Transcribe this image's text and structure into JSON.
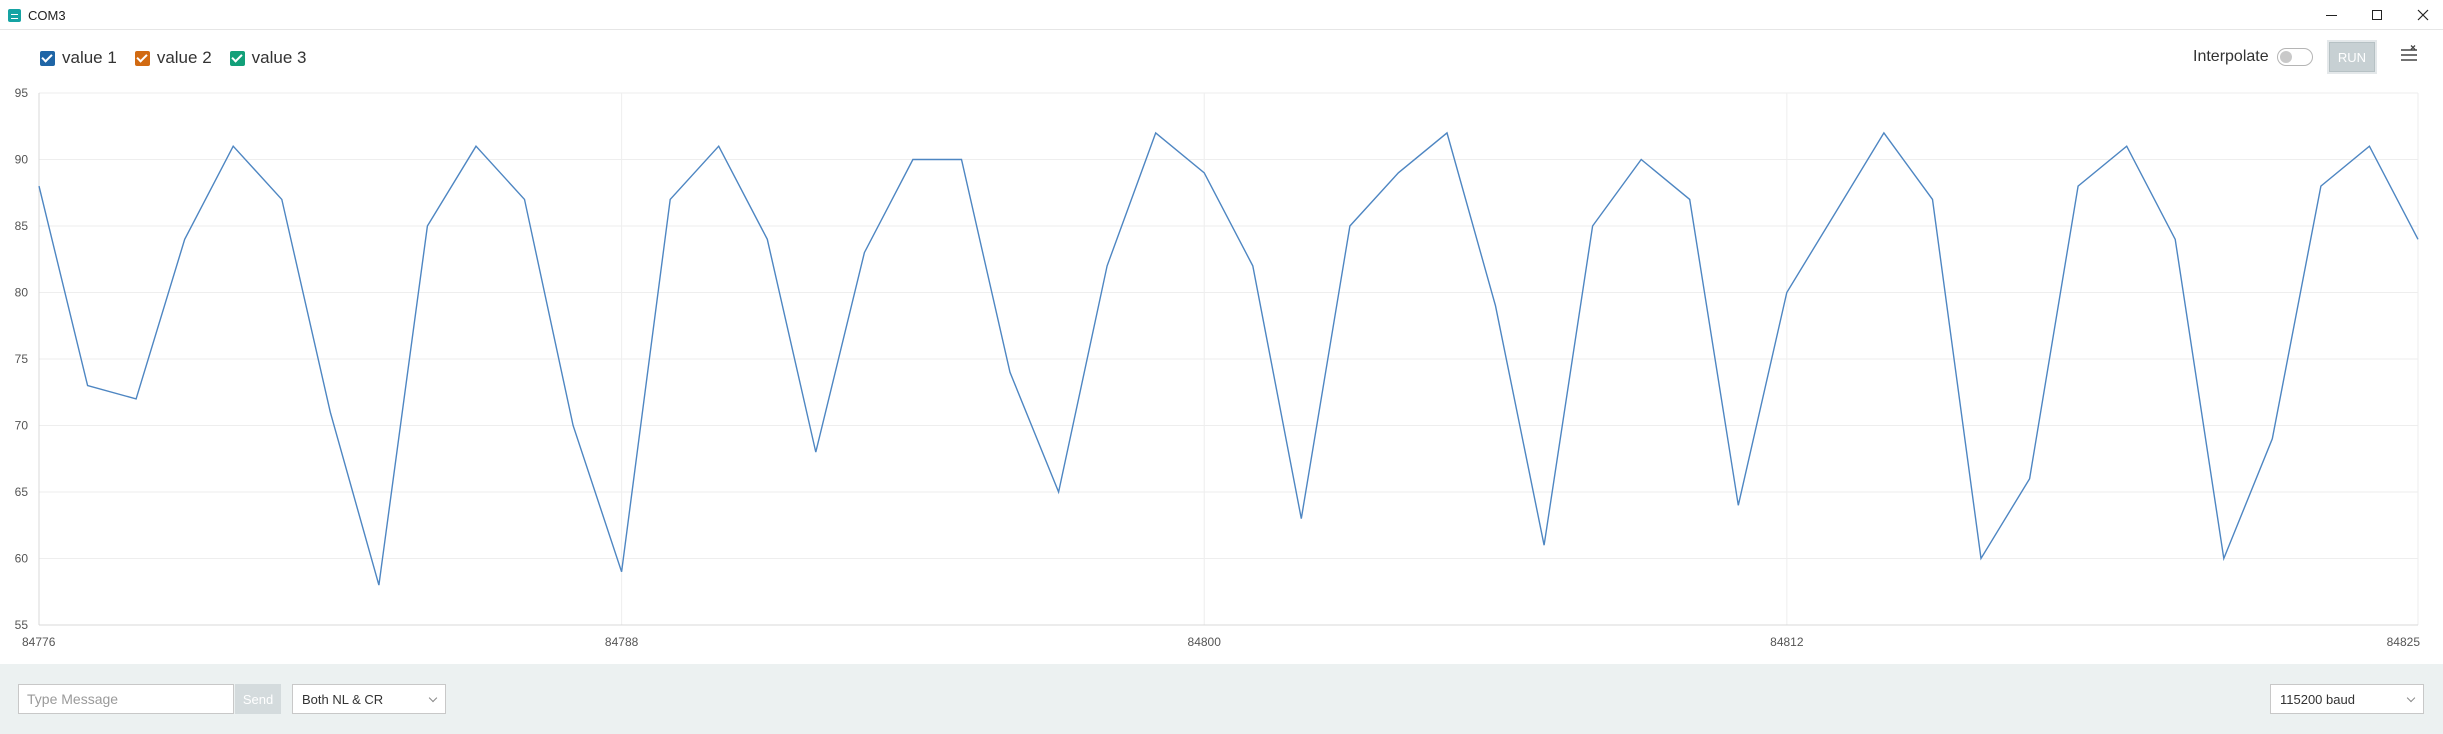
{
  "window": {
    "title": "COM3"
  },
  "legend": [
    {
      "label": "value 1",
      "color": "#1f65a6"
    },
    {
      "label": "value 2",
      "color": "#d16a12"
    },
    {
      "label": "value 3",
      "color": "#12a079"
    }
  ],
  "toolbar": {
    "interpolate_label": "Interpolate",
    "interpolate_on": false,
    "run_label": "RUN"
  },
  "chart_data": {
    "type": "line",
    "x": [
      84776,
      84777,
      84778,
      84779,
      84780,
      84781,
      84782,
      84783,
      84784,
      84785,
      84786,
      84787,
      84788,
      84789,
      84790,
      84791,
      84792,
      84793,
      84794,
      84795,
      84796,
      84797,
      84798,
      84799,
      84800,
      84801,
      84802,
      84803,
      84804,
      84805,
      84806,
      84807,
      84808,
      84809,
      84810,
      84811,
      84812,
      84813,
      84814,
      84815,
      84816,
      84817,
      84818,
      84819,
      84820,
      84821,
      84822,
      84823,
      84824,
      84825
    ],
    "series": [
      {
        "name": "value 1",
        "color": "#4e86c2",
        "values": [
          88,
          73,
          72,
          84,
          91,
          87,
          71,
          58,
          85,
          91,
          87,
          70,
          59,
          87,
          91,
          84,
          68,
          83,
          90,
          90,
          74,
          65,
          82,
          92,
          89,
          82,
          63,
          85,
          89,
          92,
          79,
          61,
          85,
          90,
          87,
          64,
          80,
          86,
          92,
          87,
          60,
          66,
          88,
          91,
          84,
          60,
          69,
          88,
          91,
          84
        ]
      }
    ],
    "x_ticks": [
      "84776",
      "84788",
      "84800",
      "84812",
      "84825"
    ],
    "y_ticks": [
      "55",
      "60",
      "65",
      "70",
      "75",
      "80",
      "85",
      "90",
      "95"
    ],
    "xlim": [
      84776,
      84825
    ],
    "ylim": [
      55,
      95
    ],
    "grid": true
  },
  "footer": {
    "message_placeholder": "Type Message",
    "send_label": "Send",
    "line_ending": "Both NL & CR",
    "baud": "115200 baud"
  }
}
